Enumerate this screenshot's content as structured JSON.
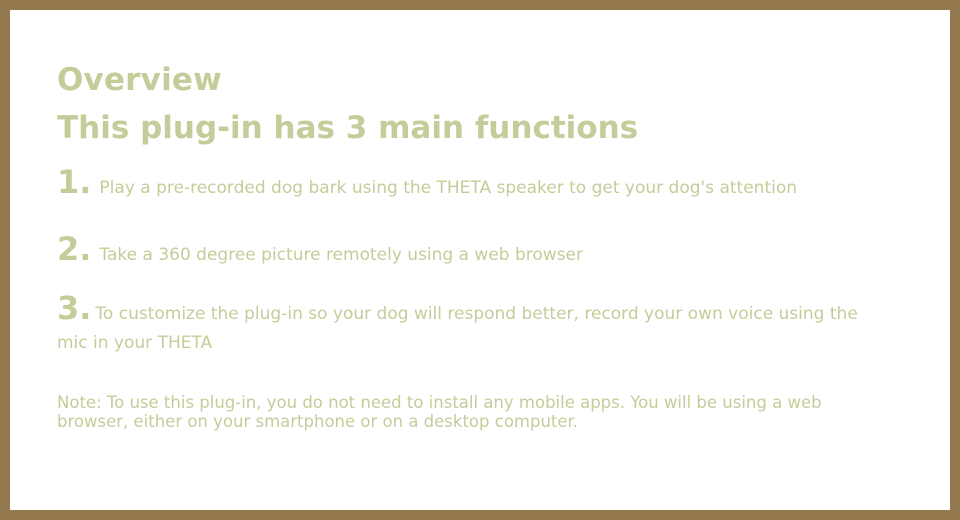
{
  "overview": {
    "title": "Overview",
    "subtitle": "This plug-in has 3 main functions",
    "items": [
      {
        "number": "1.",
        "text": "Play a pre-recorded dog bark using the THETA speaker to get your dog's attention"
      },
      {
        "number": "2.",
        "text": "Take a 360 degree picture remotely using a web browser"
      },
      {
        "number": "3.",
        "text": "To customize the plug-in so your dog will respond better, record your own voice using the mic in your THETA"
      }
    ],
    "note": "Note: To use this plug-in, you do not need to install any mobile apps. You will be using a web browser, either on your smartphone or on a desktop computer."
  },
  "colors": {
    "border": "#94784d",
    "text": "#c4cd99",
    "background": "#ffffff"
  }
}
